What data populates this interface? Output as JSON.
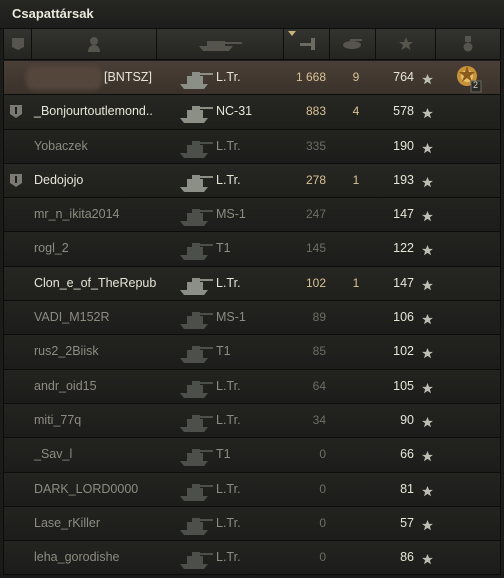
{
  "window_title": "Csapattársak",
  "columns": [
    {
      "icon": "platoon-column-icon"
    },
    {
      "icon": "player-column-icon"
    },
    {
      "icon": "tank-column-icon"
    },
    {
      "icon": "damage-column-icon",
      "sorted": "desc"
    },
    {
      "icon": "kills-column-icon"
    },
    {
      "icon": "experience-star-icon"
    },
    {
      "icon": "medal-column-icon"
    }
  ],
  "rows": [
    {
      "name": "",
      "clan": "[BNTSZ]",
      "tank": "L.Tr.",
      "damage": "1 668",
      "kills": "9",
      "xp": "764",
      "me": true,
      "alive": true,
      "platoon": false,
      "medal_count": "2"
    },
    {
      "name": "_Bonjourtoutlemond..",
      "clan": "",
      "tank": "NC-31",
      "damage": "883",
      "kills": "4",
      "xp": "578",
      "me": false,
      "alive": true,
      "platoon": true,
      "medal_count": ""
    },
    {
      "name": "Yobaczek",
      "clan": "",
      "tank": "L.Tr.",
      "damage": "335",
      "kills": "",
      "xp": "190",
      "me": false,
      "alive": false,
      "platoon": false,
      "medal_count": ""
    },
    {
      "name": "Dedojojo",
      "clan": "",
      "tank": "L.Tr.",
      "damage": "278",
      "kills": "1",
      "xp": "193",
      "me": false,
      "alive": true,
      "platoon": true,
      "medal_count": ""
    },
    {
      "name": "mr_n_ikita2014",
      "clan": "",
      "tank": "MS-1",
      "damage": "247",
      "kills": "",
      "xp": "147",
      "me": false,
      "alive": false,
      "platoon": false,
      "medal_count": ""
    },
    {
      "name": "rogl_2",
      "clan": "",
      "tank": "T1",
      "damage": "145",
      "kills": "",
      "xp": "122",
      "me": false,
      "alive": false,
      "platoon": false,
      "medal_count": ""
    },
    {
      "name": "Clon_e_of_TheRepub",
      "clan": "",
      "tank": "L.Tr.",
      "damage": "102",
      "kills": "1",
      "xp": "147",
      "me": false,
      "alive": true,
      "platoon": false,
      "medal_count": ""
    },
    {
      "name": "VADI_M152R",
      "clan": "",
      "tank": "MS-1",
      "damage": "89",
      "kills": "",
      "xp": "106",
      "me": false,
      "alive": false,
      "platoon": false,
      "medal_count": ""
    },
    {
      "name": "rus2_2Biisk",
      "clan": "",
      "tank": "T1",
      "damage": "85",
      "kills": "",
      "xp": "102",
      "me": false,
      "alive": false,
      "platoon": false,
      "medal_count": ""
    },
    {
      "name": "andr_oid15",
      "clan": "",
      "tank": "L.Tr.",
      "damage": "64",
      "kills": "",
      "xp": "105",
      "me": false,
      "alive": false,
      "platoon": false,
      "medal_count": ""
    },
    {
      "name": "miti_77q",
      "clan": "",
      "tank": "L.Tr.",
      "damage": "34",
      "kills": "",
      "xp": "90",
      "me": false,
      "alive": false,
      "platoon": false,
      "medal_count": ""
    },
    {
      "name": "_Sav_l",
      "clan": "",
      "tank": "T1",
      "damage": "0",
      "kills": "",
      "xp": "66",
      "me": false,
      "alive": false,
      "platoon": false,
      "medal_count": ""
    },
    {
      "name": "DARK_LORD0000",
      "clan": "",
      "tank": "L.Tr.",
      "damage": "0",
      "kills": "",
      "xp": "81",
      "me": false,
      "alive": false,
      "platoon": false,
      "medal_count": ""
    },
    {
      "name": "Lase_rKiller",
      "clan": "",
      "tank": "L.Tr.",
      "damage": "0",
      "kills": "",
      "xp": "57",
      "me": false,
      "alive": false,
      "platoon": false,
      "medal_count": ""
    },
    {
      "name": "leha_gorodishe",
      "clan": "",
      "tank": "L.Tr.",
      "damage": "0",
      "kills": "",
      "xp": "86",
      "me": false,
      "alive": false,
      "platoon": false,
      "medal_count": ""
    }
  ],
  "colors": {
    "me_row": "#4a3f36",
    "alive_text": "#e6e6d8",
    "dead_text": "#8c8c82",
    "damage_alive": "#d9c294"
  }
}
